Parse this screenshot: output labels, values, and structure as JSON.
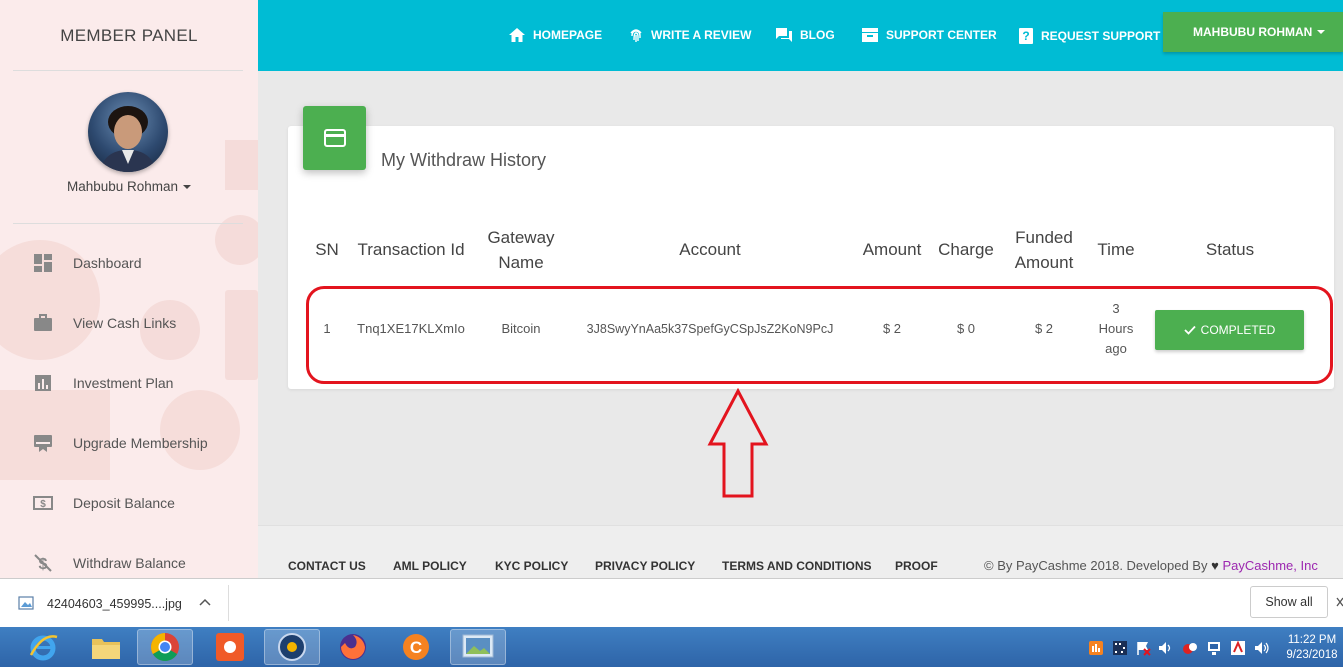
{
  "sidebar": {
    "title": "MEMBER PANEL",
    "user_name": "Mahbubu Rohman",
    "items": [
      {
        "label": "Dashboard",
        "icon": "dashboard-icon"
      },
      {
        "label": "View Cash Links",
        "icon": "briefcase-icon"
      },
      {
        "label": "Investment Plan",
        "icon": "bar-chart-icon"
      },
      {
        "label": "Upgrade Membership",
        "icon": "card-membership-icon"
      },
      {
        "label": "Deposit Balance",
        "icon": "money-icon"
      },
      {
        "label": "Withdraw Balance",
        "icon": "money-off-icon"
      }
    ]
  },
  "topbar": {
    "nav": [
      {
        "label": "HOMEPAGE",
        "icon": "home-icon"
      },
      {
        "label": "WRITE A REVIEW",
        "icon": "fingerprint-icon"
      },
      {
        "label": "BLOG",
        "icon": "forum-icon"
      },
      {
        "label": "SUPPORT CENTER",
        "icon": "inbox-icon"
      },
      {
        "label": "REQUEST SUPPORT",
        "icon": "help-icon"
      }
    ],
    "user_button": "MAHBUBU ROHMAN"
  },
  "card": {
    "title": "My Withdraw History",
    "icon": "credit-card-icon",
    "headers": {
      "sn": "SN",
      "transaction_id": "Transaction Id",
      "gateway_1": "Gateway",
      "gateway_2": "Name",
      "account": "Account",
      "amount": "Amount",
      "charge": "Charge",
      "funded_1": "Funded",
      "funded_2": "Amount",
      "time": "Time",
      "status": "Status"
    },
    "rows": [
      {
        "sn": "1",
        "transaction_id": "Tnq1XE17KLXmIo",
        "gateway": "Bitcoin",
        "account": "3J8SwyYnAa5k37SpefGyCSpJsZ2KoN9PcJ",
        "amount": "$ 2",
        "charge": "$ 0",
        "funded": "$ 2",
        "time_1": "3",
        "time_2": "Hours",
        "time_3": "ago",
        "status": "COMPLETED"
      }
    ]
  },
  "footer": {
    "links": [
      "CONTACT US",
      "AML POLICY",
      "KYC POLICY",
      "PRIVACY POLICY",
      "TERMS AND CONDITIONS",
      "PROOF"
    ],
    "copyright": "© By PayCashme 2018. Developed By",
    "brand": "PayCashme, Inc"
  },
  "download_bar": {
    "file_name": "42404603_459995....jpg",
    "show_all": "Show all"
  },
  "taskbar": {
    "time": "11:22 PM",
    "date": "9/23/2018"
  },
  "colors": {
    "topbar": "#00bcd4",
    "accent_green": "#4caf50",
    "highlight_red": "#e3141e",
    "sidebar_bg": "#fbebeb"
  }
}
